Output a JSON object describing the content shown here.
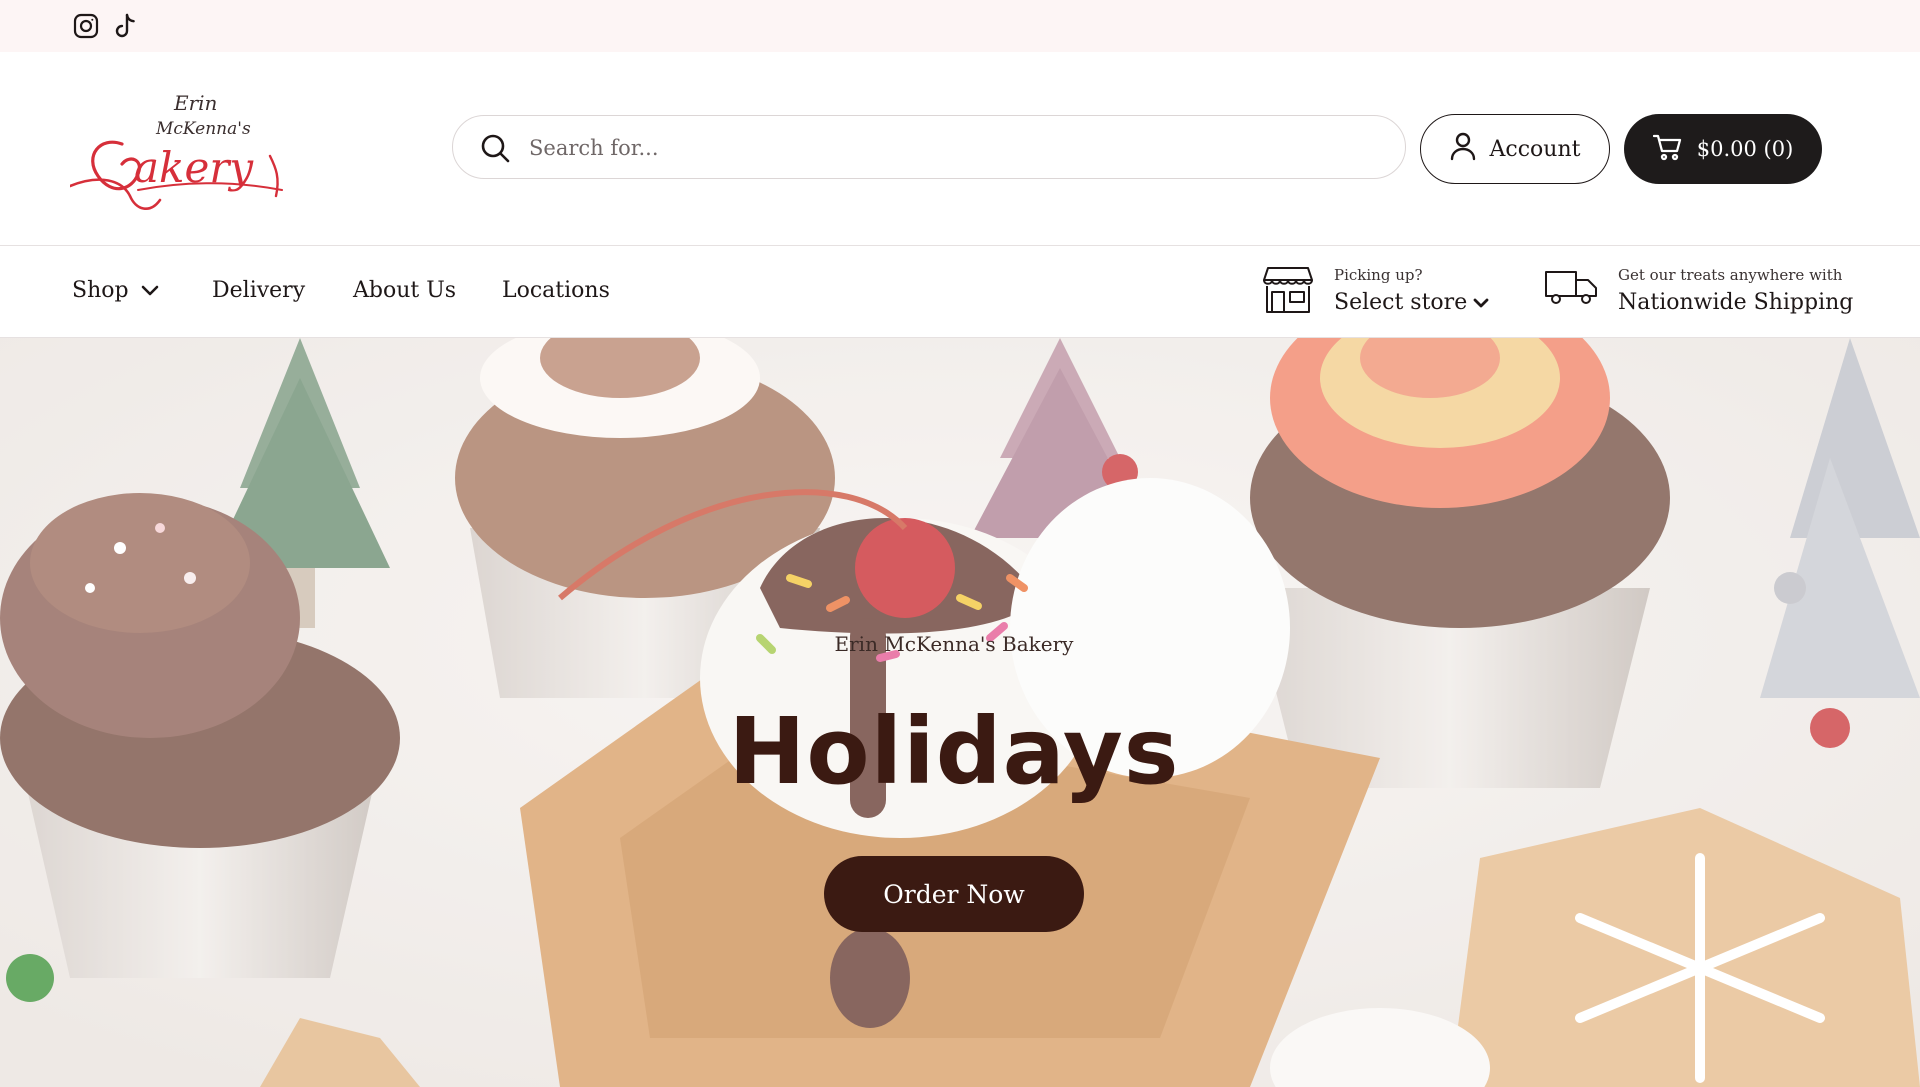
{
  "topbar": {
    "social": [
      {
        "name": "instagram-icon",
        "label": ""
      },
      {
        "name": "tiktok-icon",
        "label": ""
      }
    ]
  },
  "header": {
    "logo": {
      "line1": "Erin",
      "line2": "McKenna's",
      "line3": "Bakery",
      "brand_color": "#d62f3a"
    },
    "search": {
      "placeholder": "Search for...",
      "value": "",
      "icon": "search-icon"
    },
    "account": {
      "label": "Account",
      "icon": "user-icon"
    },
    "cart": {
      "label": "$0.00 (0)",
      "icon": "cart-icon"
    }
  },
  "nav": {
    "items": [
      {
        "label": "Shop",
        "has_dropdown": true
      },
      {
        "label": "Delivery"
      },
      {
        "label": "About Us"
      },
      {
        "label": "Locations"
      }
    ],
    "pickup": {
      "small": "Picking up?",
      "big": "Select store",
      "icon": "storefront-icon"
    },
    "shipping": {
      "small": "Get our treats anywhere with",
      "big": "Nationwide Shipping",
      "icon": "truck-icon"
    }
  },
  "hero": {
    "kicker": "Erin McKenna's Bakery",
    "title": "Holidays",
    "button_label": "Order Now",
    "title_color": "#3b1a12",
    "button_color": "#3b1a12"
  },
  "colors": {
    "topbar_bg": "#fdf5f5",
    "dark": "#1e1b1b",
    "accent": "#d62f3a"
  }
}
